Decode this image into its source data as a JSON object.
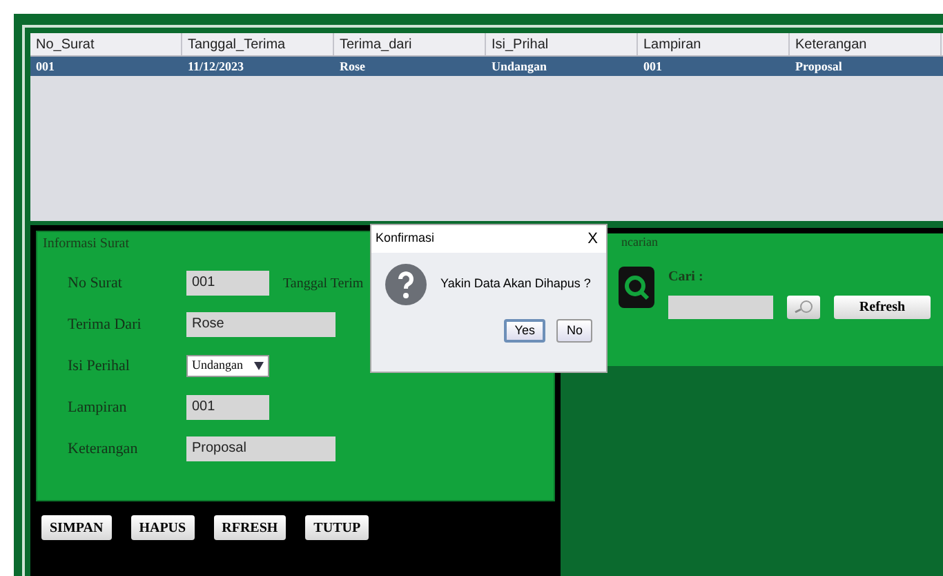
{
  "table": {
    "columns": [
      "No_Surat",
      "Tanggal_Terima",
      "Terima_dari",
      "Isi_Prihal",
      "Lampiran",
      "Keterangan"
    ],
    "rows": [
      {
        "selected": true,
        "cells": [
          "001",
          "11/12/2023",
          "Rose",
          "Undangan",
          "001",
          "Proposal"
        ]
      }
    ]
  },
  "form": {
    "title": "Informasi Surat",
    "fields": [
      {
        "kind": "text",
        "label": "No Surat",
        "value": "001",
        "extra_label": "Tanggal Terim"
      },
      {
        "kind": "text",
        "label": "Terima Dari",
        "value": "Rose"
      },
      {
        "kind": "select",
        "label": "Isi Perihal",
        "value": "Undangan"
      },
      {
        "kind": "text",
        "label": "Lampiran",
        "value": "001"
      },
      {
        "kind": "text",
        "label": "Keterangan",
        "value": "Proposal"
      }
    ]
  },
  "buttons": [
    "SIMPAN",
    "HAPUS",
    "RFRESH",
    "TUTUP"
  ],
  "search": {
    "title": "ncarian",
    "label": "Cari :",
    "refresh": "Refresh"
  },
  "dialog": {
    "title": "Konfirmasi",
    "close": "X",
    "message": "Yakin Data Akan Dihapus ?",
    "buttons": [
      {
        "label": "Yes",
        "selected": true
      },
      {
        "label": "No",
        "selected": false
      }
    ]
  }
}
